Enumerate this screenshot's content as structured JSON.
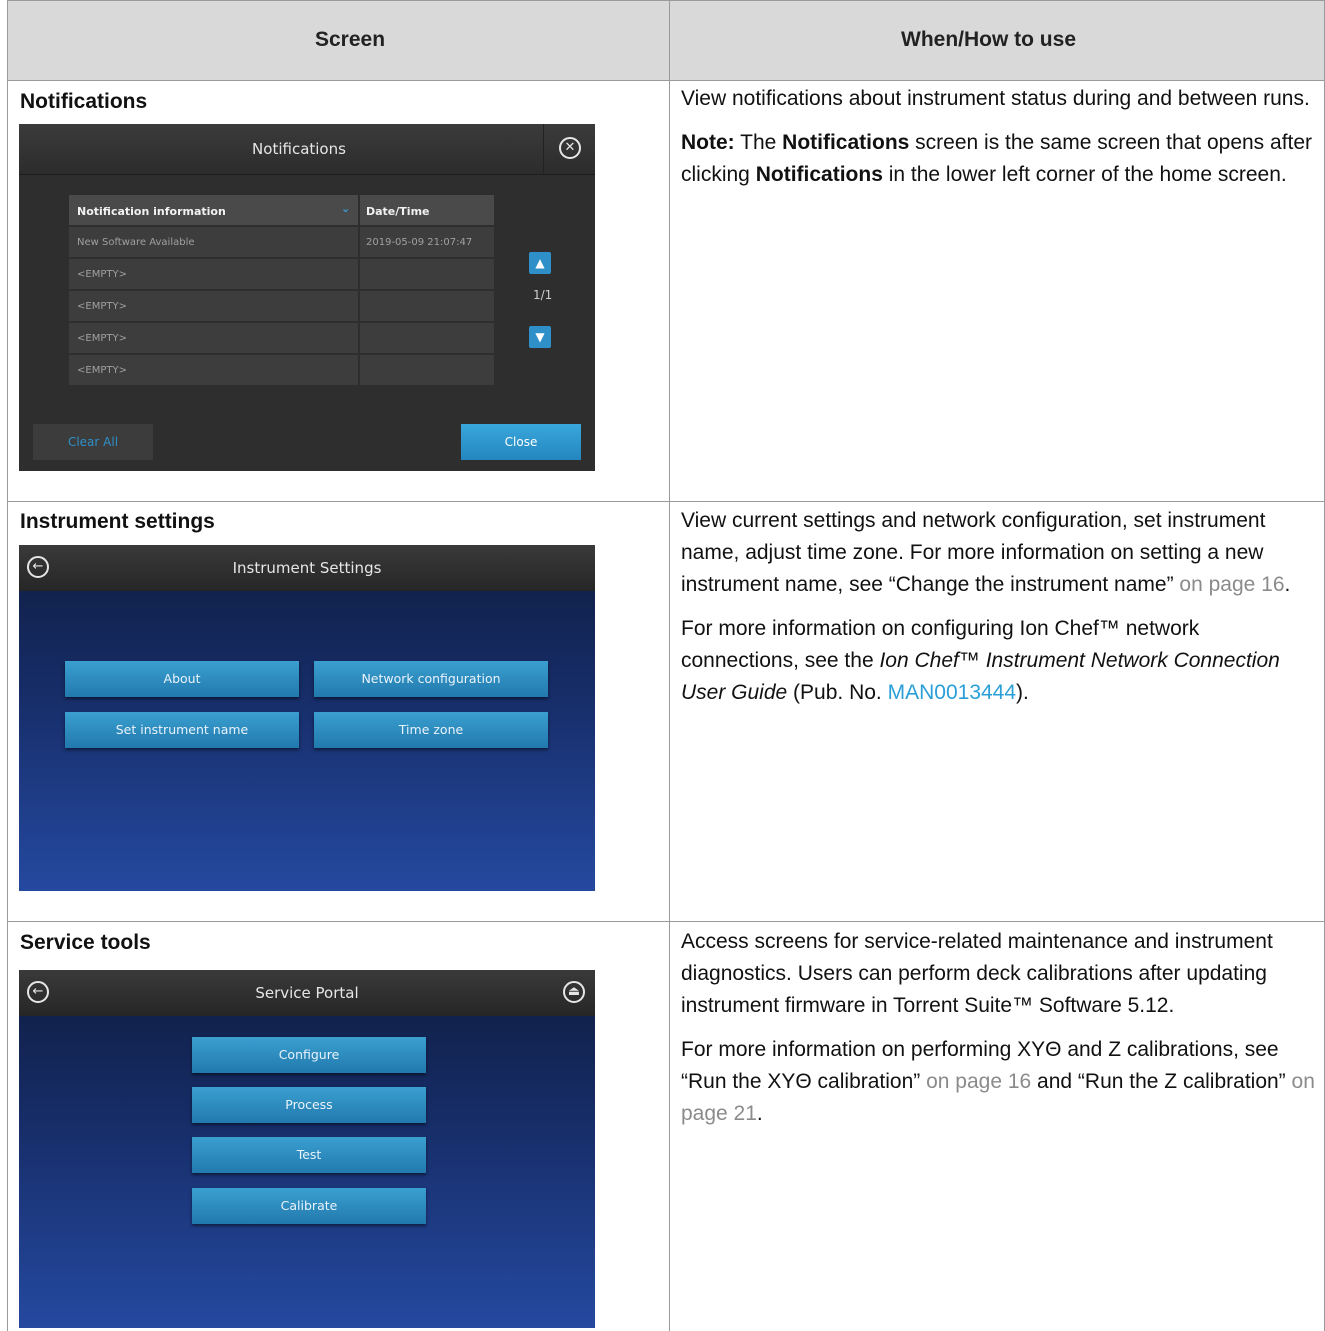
{
  "table": {
    "header_screen": "Screen",
    "header_when": "When/How to use"
  },
  "rows": [
    {
      "title": "Notifications",
      "desc_p1": "View notifications about instrument status during and between runs.",
      "note_label": "Note:",
      "note_text_a": "  The ",
      "note_bold_a": "Notifications",
      "note_text_b": " screen is the same screen that opens after clicking ",
      "note_bold_b": "Notifications",
      "note_text_c": " in the lower left corner of the home screen."
    },
    {
      "title": "Instrument settings",
      "desc_p1": "View current settings and network configuration, set instrument name, adjust time zone. For more information on setting a new instrument name, see “Change the instrument name”",
      "desc_p1_link": " on page 16",
      "desc_p1_end": ".",
      "desc_p2_a": "For more information on configuring Ion Chef™ network connections, see the ",
      "desc_p2_italic": "Ion Chef™ Instrument Network Connection User Guide",
      "desc_p2_b": " (Pub. No. ",
      "desc_p2_link": "MAN0013444",
      "desc_p2_c": ")."
    },
    {
      "title": "Service tools",
      "desc_p1": "Access screens for service-related maintenance and instrument diagnostics. Users can perform deck calibrations after updating instrument firmware in Torrent Suite™ Software 5.12.",
      "desc_p2_a": "For more information on performing XYΘ and Z calibrations, see “Run the XYΘ calibration”",
      "desc_p2_link1": " on page 16",
      "desc_p2_b": " and “Run the Z calibration”",
      "desc_p2_link2": " on page 21",
      "desc_p2_c": "."
    }
  ],
  "notifications_screen": {
    "title": "Notifications",
    "col_info": "Notification information",
    "col_date": "Date/Time",
    "rows": [
      {
        "info": "New Software Available",
        "date": "2019-05-09 21:07:47"
      },
      {
        "info": "<EMPTY>",
        "date": ""
      },
      {
        "info": "<EMPTY>",
        "date": ""
      },
      {
        "info": "<EMPTY>",
        "date": ""
      },
      {
        "info": "<EMPTY>",
        "date": ""
      }
    ],
    "page": "1/1",
    "clear_all": "Clear All",
    "close": "Close",
    "icons": [
      "close-circle-icon",
      "chevron-down-icon",
      "arrow-up-icon",
      "arrow-down-icon"
    ]
  },
  "settings_screen": {
    "title": "Instrument Settings",
    "buttons": [
      "About",
      "Network configuration",
      "Set instrument name",
      "Time zone"
    ],
    "icons": [
      "back-arrow-icon"
    ]
  },
  "service_screen": {
    "title": "Service Portal",
    "buttons": [
      "Configure",
      "Process",
      "Test",
      "Calibrate"
    ],
    "icons": [
      "back-arrow-icon",
      "eject-icon"
    ]
  },
  "colors": {
    "header_bg": "#d9d9d9",
    "link_gray": "#8b8b8b",
    "link_blue": "#2a9fd8",
    "button_blue": "#2f8fc8"
  }
}
